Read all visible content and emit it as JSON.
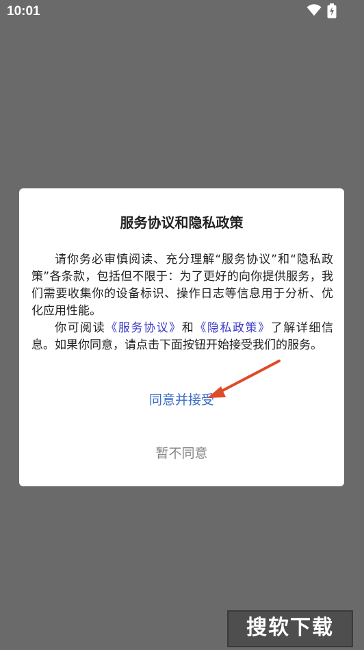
{
  "status_bar": {
    "time": "10:01",
    "icons": [
      "wifi-icon",
      "battery-charging-icon"
    ]
  },
  "dialog": {
    "title": "服务协议和隐私政策",
    "paragraph1": "请你务必审慎阅读、充分理解“服务协议”和“隐私政策”各条款，包括但不限于：为了更好的向你提供服务，我们需要收集你的设备标识、操作日志等信息用于分析、优化应用性能。",
    "paragraph2_prefix": "你可阅读",
    "service_link": "《服务协议》",
    "and_text": "和",
    "privacy_link": "《隐私政策》",
    "paragraph2_suffix": "了解详细信息。如果你同意，请点击下面按钮开始接受我们的服务。",
    "agree_label": "同意并接受",
    "decline_label": "暂不同意"
  },
  "watermark": "搜软下载",
  "colors": {
    "overlay": "#6a6a6a",
    "link": "#3a3ac8",
    "agree": "#3a6ec8",
    "decline": "#888888",
    "arrow": "#e04a2a"
  }
}
